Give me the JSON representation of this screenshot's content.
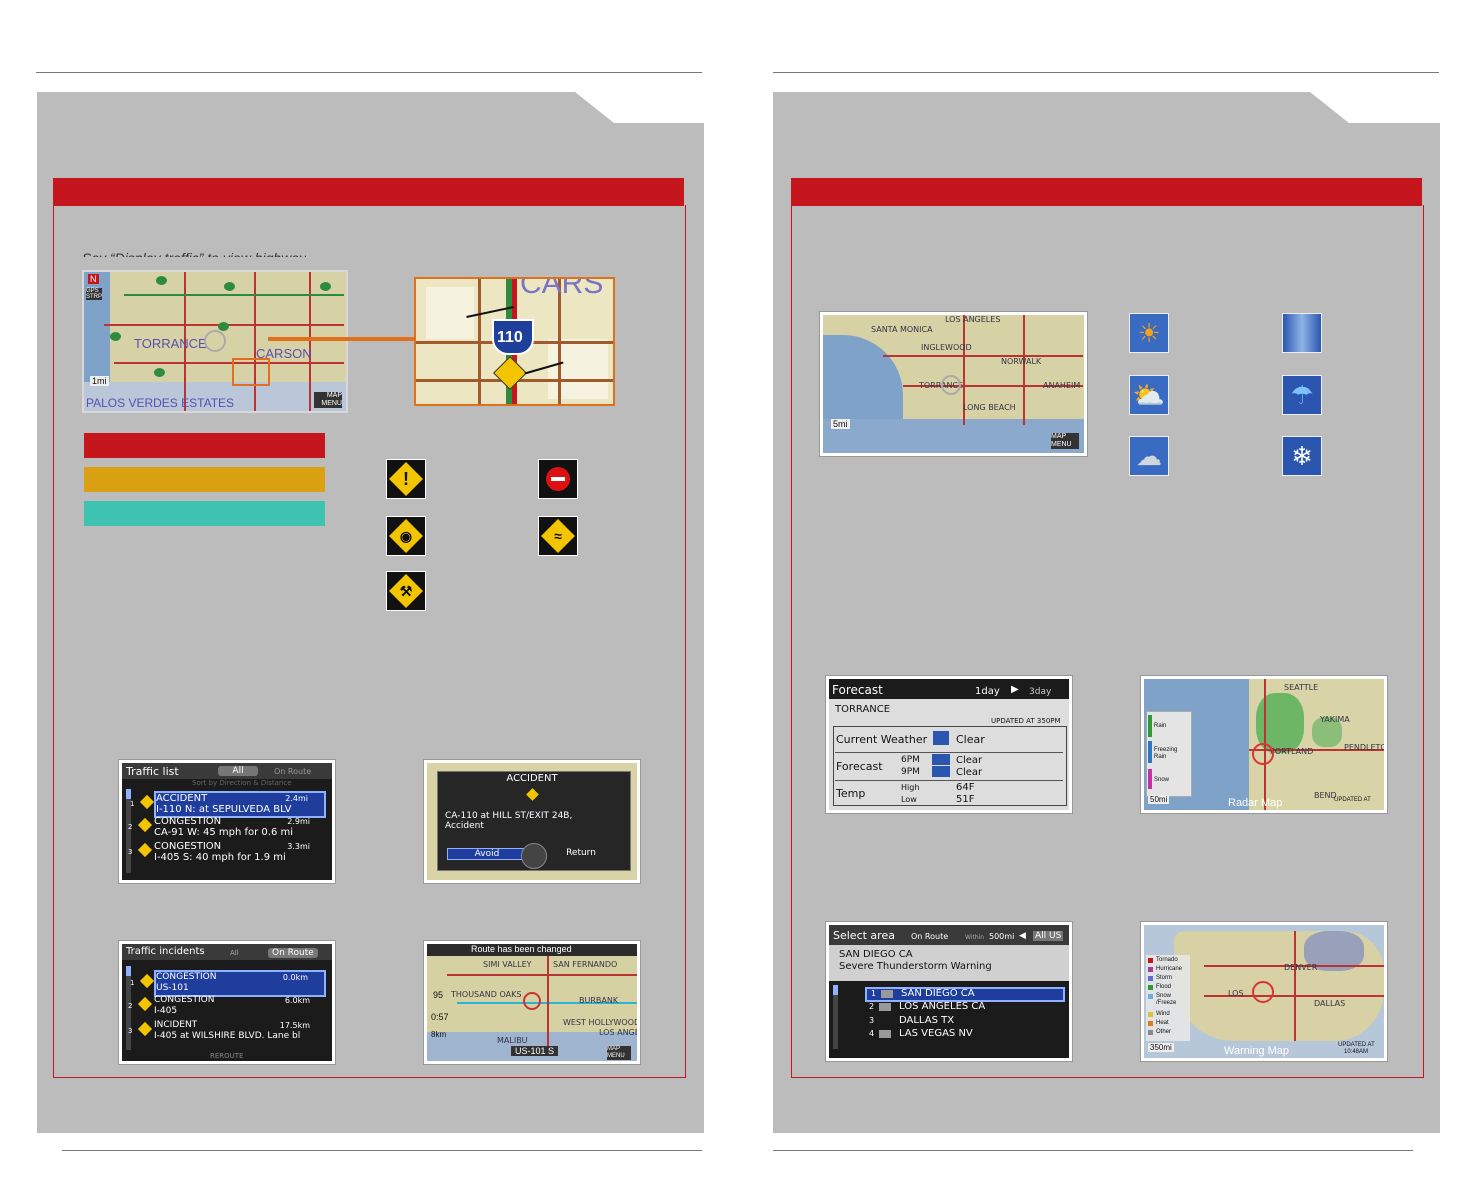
{
  "left": {
    "caption": "Say “Display traffic” to view highway",
    "map_small": {
      "cities": [
        "TORRANCE",
        "CARSON",
        "PALOS VERDES ESTATES"
      ],
      "scale": "1mi",
      "map_menu": "MAP MENU",
      "compass": "N",
      "gps": "GPS STRP",
      "route_shields": [
        "107",
        "91",
        "91",
        "1",
        "405",
        "110",
        "107",
        "1",
        "91"
      ]
    },
    "map_zoom": {
      "city": "CARS",
      "interstate": "110",
      "interstate_top": "INTERSTATE"
    },
    "legend_colors": [
      "#c4161c",
      "#d9a011",
      "#3fc3b1"
    ],
    "traffic_icons": [
      "incident-icon",
      "closure-icon",
      "accident-icon",
      "weather-road-icon",
      "construction-icon"
    ],
    "traffic_list": {
      "title": "Traffic list",
      "tab_all": "All",
      "tab_on_route": "On Route",
      "subtitle": "Sort by Direction & Distance",
      "rows": [
        {
          "num": "1",
          "type": "ACCIDENT",
          "dist": "2.4mi",
          "desc": "I-110 N: at SEPULVEDA BLV"
        },
        {
          "num": "2",
          "type": "CONGESTION",
          "dist": "2.9mi",
          "desc": "CA-91 W: 45 mph for 0.6 mi"
        },
        {
          "num": "3",
          "type": "CONGESTION",
          "dist": "3.3mi",
          "desc": "I-405 S: 40 mph for 1.9 mi"
        }
      ]
    },
    "accident_popup": {
      "title": "ACCIDENT",
      "body1": "CA-110 at HILL ST/EXIT 24B,",
      "body2": "Accident",
      "avoid": "Avoid",
      "return": "Return"
    },
    "traffic_incidents": {
      "title": "Traffic incidents",
      "tab_all": "All",
      "tab_on_route": "On Route",
      "rows": [
        {
          "num": "1",
          "type": "CONGESTION",
          "dist": "0.0km",
          "desc": "US-101"
        },
        {
          "num": "2",
          "type": "CONGESTION",
          "dist": "6.0km",
          "desc": "I-405"
        },
        {
          "num": "3",
          "type": "INCIDENT",
          "dist": "17.5km",
          "desc": "I-405 at WILSHIRE BLVD. Lane bl"
        }
      ],
      "footer": "REROUTE"
    },
    "route_changed": {
      "title": "Route has been changed",
      "cities": [
        "SIMI VALLEY",
        "SAN FERNANDO",
        "THOUSAND OAKS",
        "BURBANK",
        "WEST HOLLYWOOD",
        "LOS ANGELES",
        "MALIBU"
      ],
      "dist": "95",
      "time": "0:57",
      "scale": "8km",
      "road": "US-101 S",
      "map_menu": "MAP MENU"
    }
  },
  "right": {
    "weather_map": {
      "cities": [
        "SANTA MONICA",
        "LOS ANGELES",
        "INGLEWOOD",
        "NORWALK",
        "TORRANCE",
        "ANAHEIM",
        "LONG BEACH"
      ],
      "scale": "5mi",
      "map_menu": "MAP MENU"
    },
    "weather_icons": [
      "sunny-icon",
      "fog-icon",
      "partly-cloudy-icon",
      "rain-umbrella-icon",
      "cloudy-icon",
      "snow-icon"
    ],
    "forecast": {
      "title": "Forecast",
      "tab_1day": "1day",
      "tab_3day": "3day",
      "location": "TORRANCE",
      "updated": "UPDATED AT 350PM",
      "current_label": "Current Weather",
      "current_value": "Clear",
      "forecast_label": "Forecast",
      "time1": "6PM",
      "time1_value": "Clear",
      "time2": "9PM",
      "time2_value": "Clear",
      "temp_label": "Temp",
      "high_label": "High",
      "high_value": "64F",
      "low_label": "Low",
      "low_value": "51F"
    },
    "radar_map": {
      "title": "Radar Map",
      "scale": "50mi",
      "updated": "UPDATED AT",
      "legend": [
        "Rain",
        "Freezing Rain",
        "Snow"
      ],
      "cities": [
        "SEATTLE",
        "YAKIMA",
        "PORTLAND",
        "PENDLETON",
        "BEND"
      ]
    },
    "select_area": {
      "title": "Select area",
      "tab_on_route": "On Route",
      "tab_within": "Within",
      "within_value": "500mi",
      "tab_all_us": "All US",
      "header_city": "SAN DIEGO CA",
      "header_warning": "Severe Thunderstorm Warning",
      "rows": [
        {
          "num": "1",
          "city": "SAN DIEGO CA"
        },
        {
          "num": "2",
          "city": "LOS ANGELES CA"
        },
        {
          "num": "3",
          "city": "DALLAS TX"
        },
        {
          "num": "4",
          "city": "LAS VEGAS NV"
        }
      ]
    },
    "warning_map": {
      "title": "Warning Map",
      "scale": "350mi",
      "updated": "UPDATED AT",
      "updated_time": "10:48AM",
      "legend": [
        "Tornado",
        "Hurricane",
        "Storm",
        "Flood",
        "Snow /Freeze",
        "Wind",
        "Heat",
        "Other"
      ],
      "cities": [
        "DENVER",
        "DALLAS",
        "LOS"
      ]
    }
  }
}
